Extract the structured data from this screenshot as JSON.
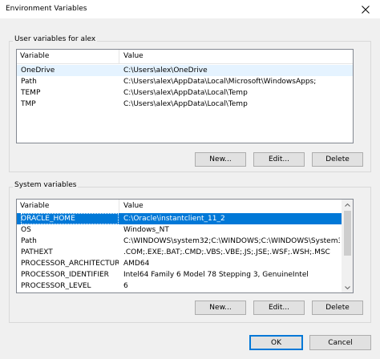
{
  "window": {
    "title": "Environment Variables"
  },
  "user_vars": {
    "label": "User variables for alex",
    "columns": [
      "Variable",
      "Value"
    ],
    "rows": [
      {
        "variable": "OneDrive",
        "value": "C:\\Users\\alex\\OneDrive"
      },
      {
        "variable": "Path",
        "value": "C:\\Users\\alex\\AppData\\Local\\Microsoft\\WindowsApps;"
      },
      {
        "variable": "TEMP",
        "value": "C:\\Users\\alex\\AppData\\Local\\Temp"
      },
      {
        "variable": "TMP",
        "value": "C:\\Users\\alex\\AppData\\Local\\Temp"
      }
    ],
    "buttons": {
      "new": "New...",
      "edit": "Edit...",
      "delete": "Delete"
    }
  },
  "system_vars": {
    "label": "System variables",
    "columns": [
      "Variable",
      "Value"
    ],
    "rows": [
      {
        "variable": "ORACLE_HOME",
        "value": "C:\\Oracle\\instantclient_11_2"
      },
      {
        "variable": "OS",
        "value": "Windows_NT"
      },
      {
        "variable": "Path",
        "value": "C:\\WINDOWS\\system32;C:\\WINDOWS;C:\\WINDOWS\\System32\\Wb..."
      },
      {
        "variable": "PATHEXT",
        "value": ".COM;.EXE;.BAT;.CMD;.VBS;.VBE;.JS;.JSE;.WSF;.WSH;.MSC"
      },
      {
        "variable": "PROCESSOR_ARCHITECTURE",
        "value": "AMD64"
      },
      {
        "variable": "PROCESSOR_IDENTIFIER",
        "value": "Intel64 Family 6 Model 78 Stepping 3, GenuineIntel"
      },
      {
        "variable": "PROCESSOR_LEVEL",
        "value": "6"
      }
    ],
    "buttons": {
      "new": "New...",
      "edit": "Edit...",
      "delete": "Delete"
    }
  },
  "footer": {
    "ok": "OK",
    "cancel": "Cancel"
  },
  "colors": {
    "selection": "#0078d7",
    "hover": "#e5f3ff",
    "button_face": "#e1e1e1"
  }
}
